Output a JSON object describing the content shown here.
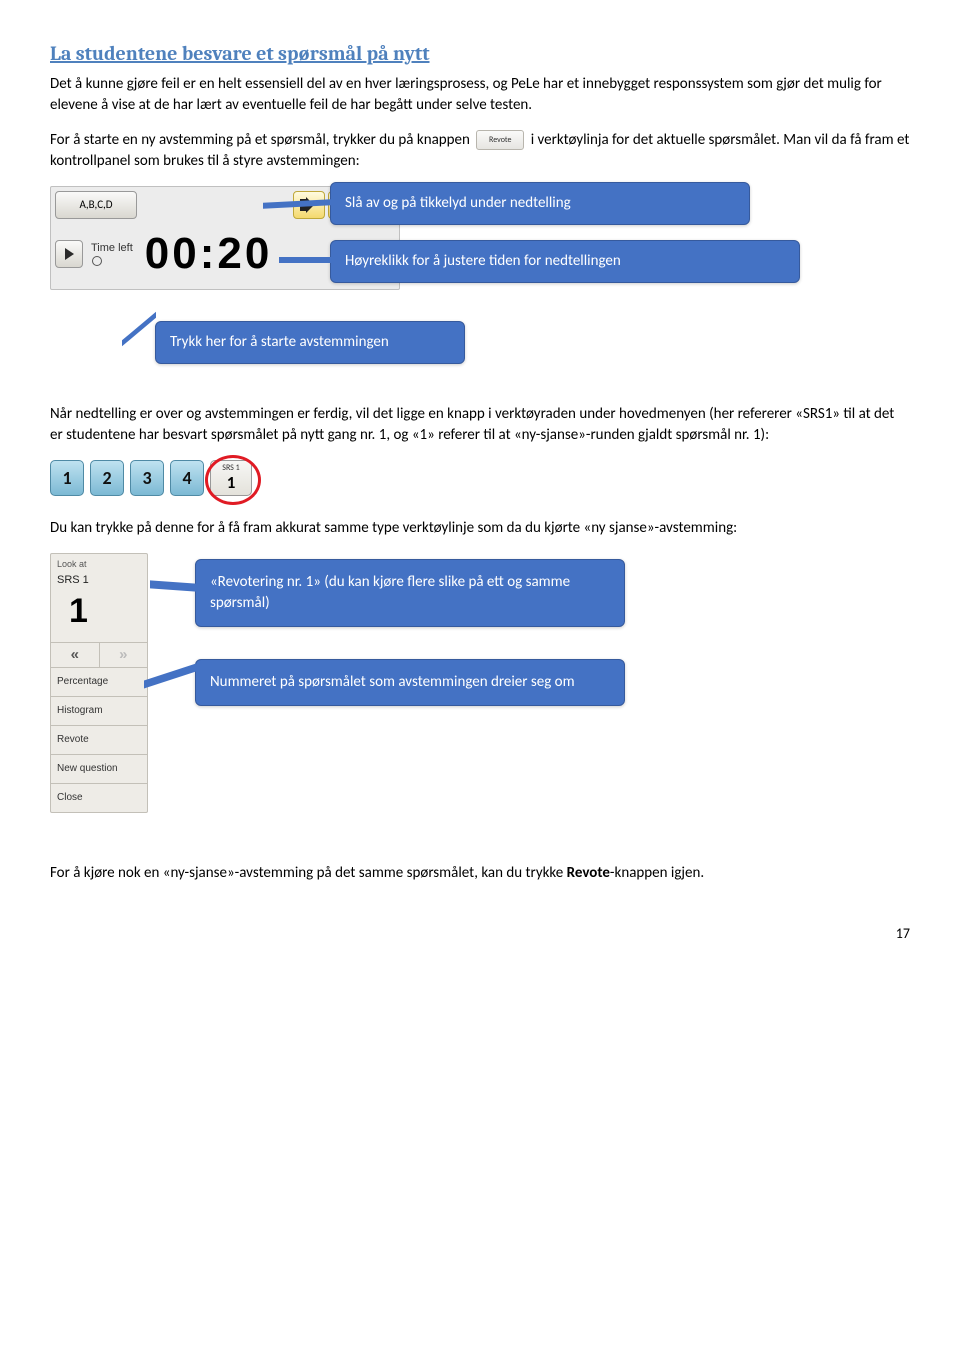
{
  "heading": "La studentene besvare et spørsmål på nytt",
  "para1": "Det å kunne gjøre feil er en helt essensiell del av en hver læringsprosess, og PeLe har et innebygget responssystem som gjør det mulig for elevene å vise at de har lært av eventuelle feil de har begått under selve testen.",
  "para2_a": "For å starte en ny avstemming på et spørsmål, trykker du på knappen ",
  "para2_b": " i verktøylinja for det aktuelle spørsmålet. Man vil da få fram et kontrollpanel som brukes til å styre avstemmingen:",
  "revote_label": "Revote",
  "control_panel": {
    "abcd": "A,B,C,D",
    "time_left_label": "Time left",
    "timer": "00:20"
  },
  "callout1": "Slå av og på tikkelyd under nedtelling",
  "callout2": "Høyreklikk for å justere tiden for nedtellingen",
  "callout3": "Trykk her for å starte avstemmingen",
  "para3": "Når nedtelling er over og avstemmingen er ferdig, vil det ligge en knapp i verktøyraden under hovedmenyen (her refererer «SRS1» til at det er studentene har besvart spørsmålet på nytt gang nr. 1, og «1» referer til at «ny-sjanse»-runden gjaldt spørsmål nr. 1):",
  "numbers": [
    "1",
    "2",
    "3",
    "4"
  ],
  "srs_small_label": "SRS 1",
  "srs_small_num": "1",
  "para4": "Du kan trykke på denne for å få fram akkurat samme type verktøylinje som da du kjørte «ny sjanse»-avstemming:",
  "lookat": {
    "head": "Look at",
    "srs": "SRS 1",
    "big": "1",
    "arrow_left": "«",
    "arrow_right": "»",
    "items": [
      "Percentage",
      "Histogram",
      "Revote",
      "New question",
      "Close"
    ]
  },
  "callout4": "«Revotering nr. 1» (du kan kjøre flere slike på ett og samme spørsmål)",
  "callout5": "Nummeret på spørsmålet som avstemmingen dreier seg om",
  "para5_a": "For å kjøre nok en «ny-sjanse»-avstemming på det samme spørsmålet, kan du trykke ",
  "para5_bold": "Revote",
  "para5_b": "-knappen igjen.",
  "page": "17"
}
